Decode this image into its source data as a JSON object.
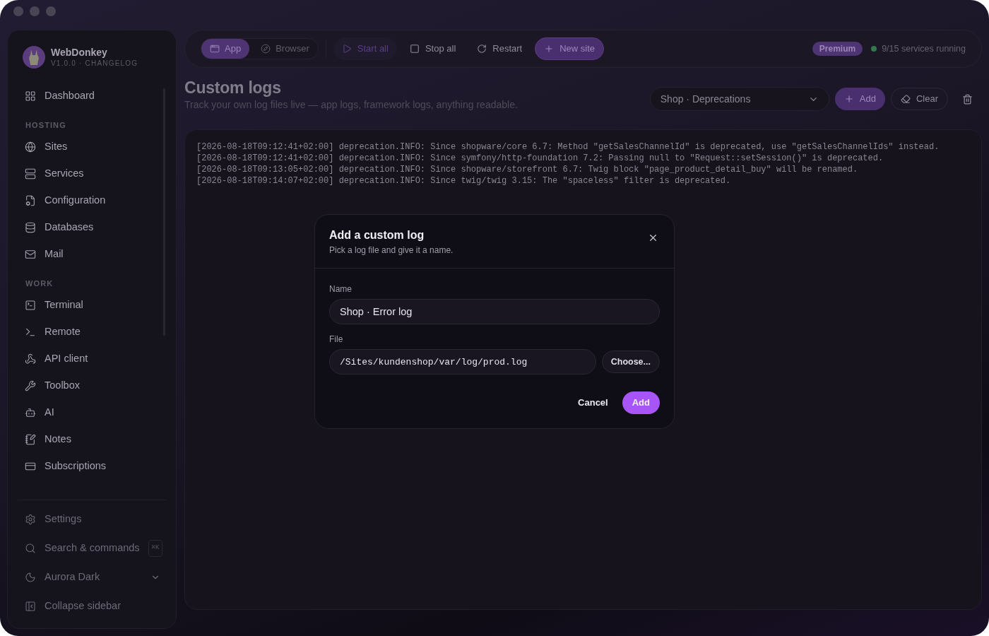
{
  "app": {
    "name": "WebDonkey",
    "version": "V1.0.0 · CHANGELOG"
  },
  "sidebar": {
    "top_items": [
      {
        "label": "Dashboard"
      }
    ],
    "sections": [
      {
        "heading": "HOSTING",
        "items": [
          {
            "label": "Sites"
          },
          {
            "label": "Services"
          },
          {
            "label": "Configuration"
          },
          {
            "label": "Databases"
          },
          {
            "label": "Mail"
          }
        ]
      },
      {
        "heading": "WORK",
        "items": [
          {
            "label": "Terminal"
          },
          {
            "label": "Remote"
          },
          {
            "label": "API client"
          },
          {
            "label": "Toolbox"
          },
          {
            "label": "AI"
          },
          {
            "label": "Notes"
          },
          {
            "label": "Subscriptions"
          }
        ]
      }
    ],
    "footer_items": [
      {
        "label": "Settings",
        "kind": "link"
      },
      {
        "label": "Search & commands",
        "kind": "shortcut",
        "shortcut": "⌘K"
      },
      {
        "label": "Aurora Dark",
        "kind": "dropdown"
      },
      {
        "label": "Collapse sidebar",
        "kind": "link"
      }
    ]
  },
  "toolbar": {
    "view_switch": [
      {
        "label": "App",
        "selected": true
      },
      {
        "label": "Browser",
        "selected": false
      }
    ],
    "actions": [
      {
        "label": "Start all",
        "kind": "soft"
      },
      {
        "label": "Stop all",
        "kind": "plain"
      },
      {
        "label": "Restart",
        "kind": "plain"
      },
      {
        "label": "New site",
        "kind": "primary"
      }
    ],
    "badge": "Premium",
    "status": {
      "text": "9/15 services running",
      "online": true
    }
  },
  "page": {
    "title": "Custom logs",
    "subtitle": "Track your own log files live — app logs, framework logs, anything readable.",
    "log_select": {
      "value": "Shop · Deprecations"
    },
    "actions": [
      {
        "label": "Add",
        "kind": "primary"
      },
      {
        "label": "Clear",
        "kind": "outline"
      }
    ],
    "log_lines": [
      "[2026-08-18T09:12:41+02:00] deprecation.INFO: Since shopware/core 6.7: Method \"getSalesChannelId\" is deprecated, use \"getSalesChannelIds\" instead.",
      "[2026-08-18T09:12:41+02:00] deprecation.INFO: Since symfony/http-foundation 7.2: Passing null to \"Request::setSession()\" is deprecated.",
      "[2026-08-18T09:13:05+02:00] deprecation.INFO: Since shopware/storefront 6.7: Twig block \"page_product_detail_buy\" will be renamed.",
      "[2026-08-18T09:14:07+02:00] deprecation.INFO: Since twig/twig 3.15: The \"spaceless\" filter is deprecated."
    ]
  },
  "dialog": {
    "title": "Add a custom log",
    "subtitle": "Pick a log file and give it a name.",
    "fields": [
      {
        "label": "Name",
        "kind": "text",
        "value": "Shop · Error log"
      },
      {
        "label": "File",
        "kind": "path",
        "value": "/Sites/kundenshop/var/log/prod.log",
        "button": "Choose..."
      }
    ],
    "buttons": [
      {
        "label": "Cancel",
        "kind": "plain"
      },
      {
        "label": "Add",
        "kind": "primary"
      }
    ]
  }
}
